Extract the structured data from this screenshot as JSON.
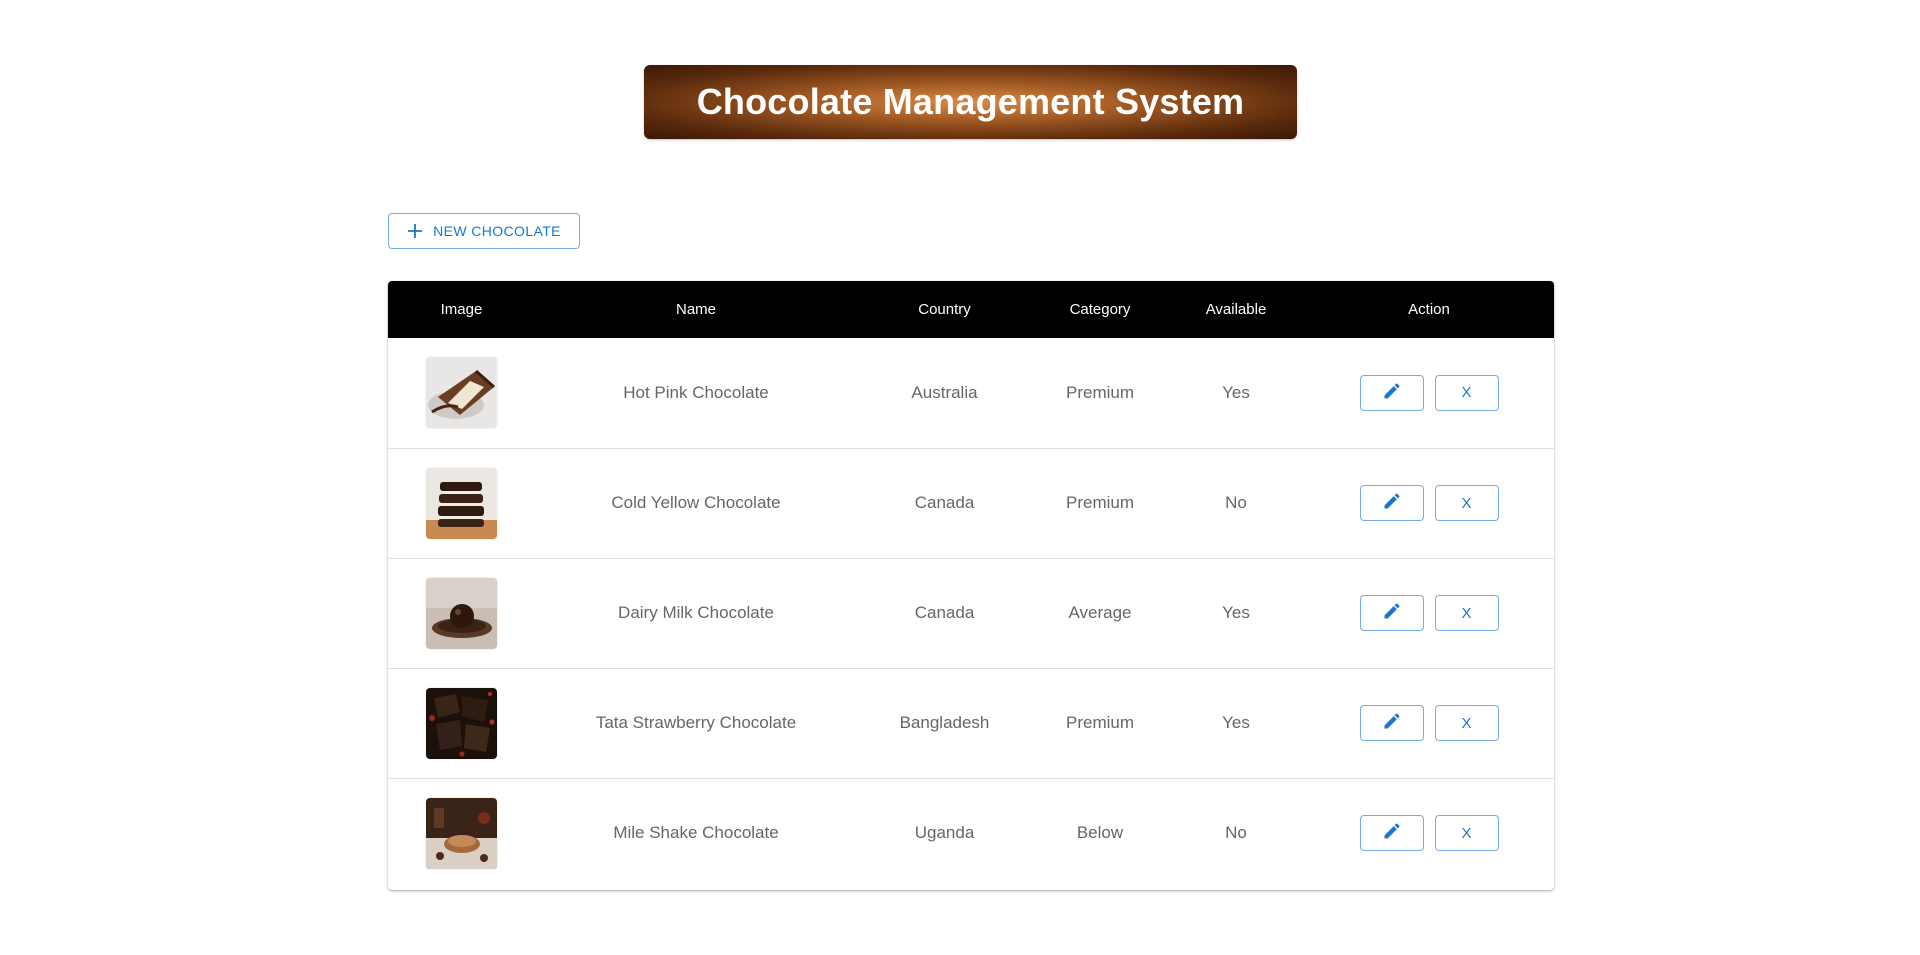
{
  "header": {
    "title": "Chocolate Management System"
  },
  "toolbar": {
    "new_label": "NEW CHOCOLATE",
    "new_icon": "plus-icon"
  },
  "table": {
    "columns": [
      "Image",
      "Name",
      "Country",
      "Category",
      "Available",
      "Action"
    ],
    "rows": [
      {
        "name": "Hot Pink Chocolate",
        "country": "Australia",
        "category": "Premium",
        "available": "Yes",
        "image": "chocolate-bar-slice-image"
      },
      {
        "name": "Cold Yellow Chocolate",
        "country": "Canada",
        "category": "Premium",
        "available": "No",
        "image": "stacked-cookies-image"
      },
      {
        "name": "Dairy Milk Chocolate",
        "country": "Canada",
        "category": "Average",
        "available": "Yes",
        "image": "chocolate-truffle-image"
      },
      {
        "name": "Tata Strawberry Chocolate",
        "country": "Bangladesh",
        "category": "Premium",
        "available": "Yes",
        "image": "dark-chocolate-pieces-image"
      },
      {
        "name": "Mile Shake Chocolate",
        "country": "Uganda",
        "category": "Below",
        "available": "No",
        "image": "chocolate-table-spread-image"
      }
    ],
    "edit_icon": "pencil-icon",
    "delete_label": "X"
  },
  "colors": {
    "accent": "#1976d2",
    "header_bg": "#000000",
    "banner_dark": "#3b1806",
    "banner_light": "#d98b45"
  }
}
